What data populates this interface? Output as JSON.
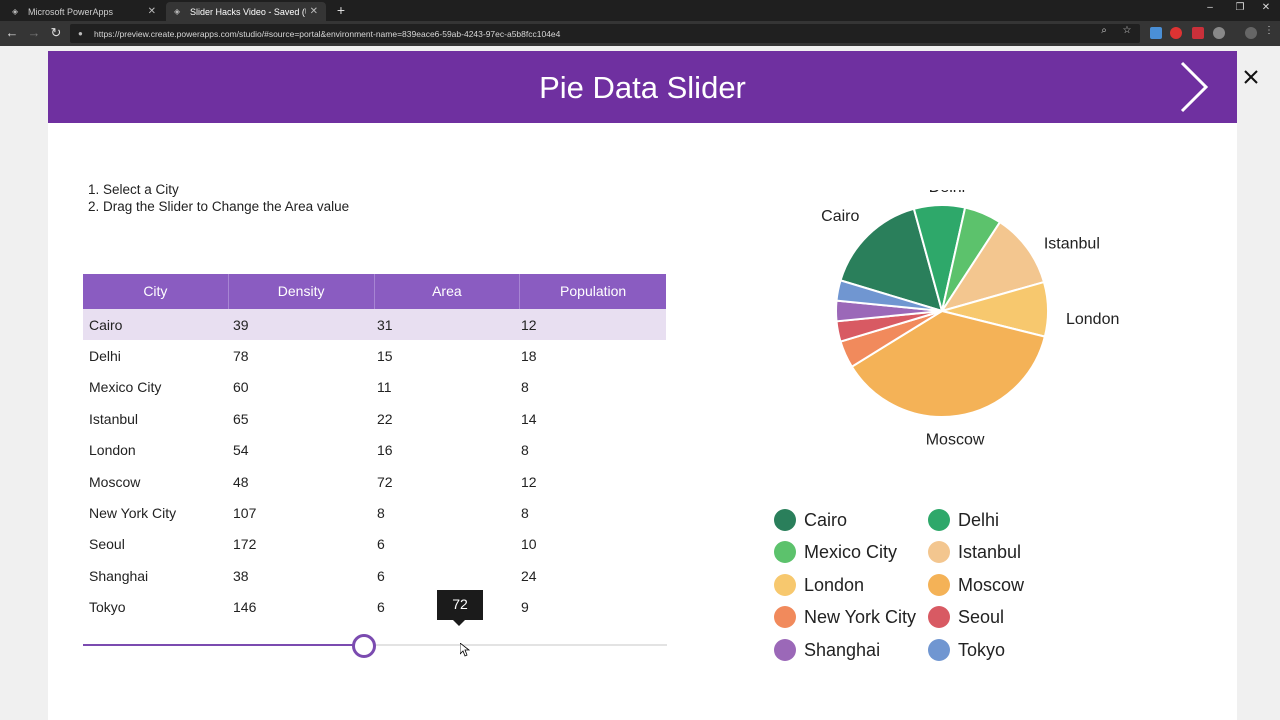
{
  "browser": {
    "tabs": [
      {
        "label": "Microsoft PowerApps",
        "active": false
      },
      {
        "label": "Slider Hacks Video - Saved (Unpublished)",
        "active": true
      }
    ],
    "url": "https://preview.create.powerapps.com/studio/#source=portal&environment-name=839eace6-59ab-4243-97ec-a5b8fcc104e4"
  },
  "app": {
    "title": "Pie Data Slider",
    "instructions": [
      "1. Select a City",
      "2. Drag the Slider to Change the Area value"
    ],
    "header_color": "#6f30a0"
  },
  "table": {
    "columns": [
      "City",
      "Density",
      "Area",
      "Population"
    ],
    "rows": [
      {
        "city": "Cairo",
        "density": "39",
        "area": "31",
        "population": "12",
        "selected": true
      },
      {
        "city": "Delhi",
        "density": "78",
        "area": "15",
        "population": "18"
      },
      {
        "city": "Mexico City",
        "density": "60",
        "area": "11",
        "population": "8"
      },
      {
        "city": "Istanbul",
        "density": "65",
        "area": "22",
        "population": "14"
      },
      {
        "city": "London",
        "density": "54",
        "area": "16",
        "population": "8"
      },
      {
        "city": "Moscow",
        "density": "48",
        "area": "72",
        "population": "12"
      },
      {
        "city": "New York City",
        "density": "107",
        "area": "8",
        "population": "8"
      },
      {
        "city": "Seoul",
        "density": "172",
        "area": "6",
        "population": "10"
      },
      {
        "city": "Shanghai",
        "density": "38",
        "area": "6",
        "population": "24"
      },
      {
        "city": "Tokyo",
        "density": "146",
        "area": "6",
        "population": "9"
      }
    ]
  },
  "slider": {
    "value": 72,
    "min": 0,
    "max": 150,
    "tooltip": "72"
  },
  "chart_data": {
    "type": "pie",
    "slices": [
      {
        "label": "Cairo",
        "value": 31,
        "color": "#2a7f5b",
        "show_label": true
      },
      {
        "label": "Delhi",
        "value": 15,
        "color": "#2ea86a",
        "show_label": true
      },
      {
        "label": "Mexico City",
        "value": 11,
        "color": "#5cc26c",
        "show_label": false
      },
      {
        "label": "Istanbul",
        "value": 22,
        "color": "#f3c68f",
        "show_label": true
      },
      {
        "label": "London",
        "value": 16,
        "color": "#f7c86e",
        "show_label": true
      },
      {
        "label": "Moscow",
        "value": 72,
        "color": "#f4b257",
        "show_label": true
      },
      {
        "label": "New York City",
        "value": 8,
        "color": "#f18a5c",
        "show_label": false
      },
      {
        "label": "Seoul",
        "value": 6,
        "color": "#d85a63",
        "show_label": false
      },
      {
        "label": "Shanghai",
        "value": 6,
        "color": "#9b68b8",
        "show_label": false
      },
      {
        "label": "Tokyo",
        "value": 6,
        "color": "#7096d1",
        "show_label": false
      }
    ]
  },
  "legend": [
    {
      "label": "Cairo",
      "color": "#2a7f5b"
    },
    {
      "label": "Delhi",
      "color": "#2ea86a"
    },
    {
      "label": "Mexico City",
      "color": "#5cc26c"
    },
    {
      "label": "Istanbul",
      "color": "#f3c68f"
    },
    {
      "label": "London",
      "color": "#f7c86e"
    },
    {
      "label": "Moscow",
      "color": "#f4b257"
    },
    {
      "label": "New York City",
      "color": "#f18a5c"
    },
    {
      "label": "Seoul",
      "color": "#d85a63"
    },
    {
      "label": "Shanghai",
      "color": "#9b68b8"
    },
    {
      "label": "Tokyo",
      "color": "#7096d1"
    }
  ]
}
